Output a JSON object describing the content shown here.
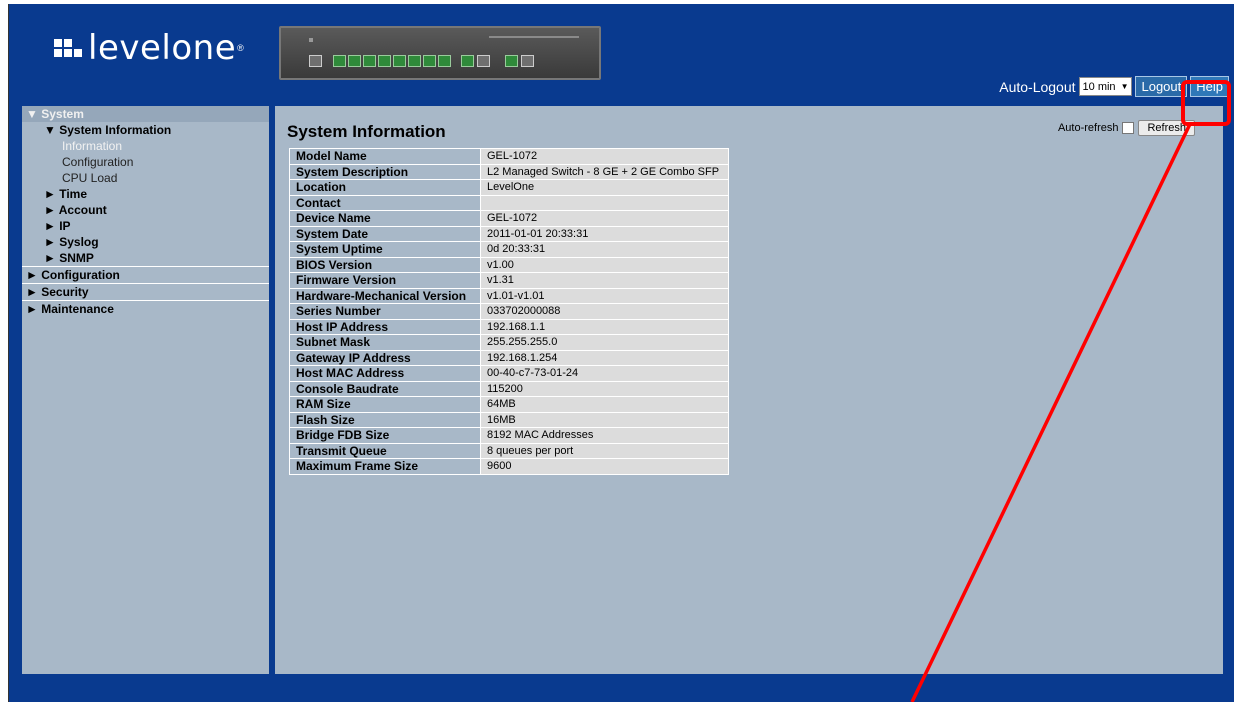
{
  "brand": {
    "name": "levelone",
    "reg": "®"
  },
  "header": {
    "auto_logout_label": "Auto-Logout",
    "auto_logout_value": "10 min",
    "logout_label": "Logout",
    "help_label": "Help"
  },
  "sidebar": {
    "system": "▼ System",
    "system_information": "▼ System Information",
    "information": "Information",
    "configuration_leaf": "Configuration",
    "cpu_load": "CPU Load",
    "time": "► Time",
    "account": "► Account",
    "ip": "► IP",
    "syslog": "► Syslog",
    "snmp": "► SNMP",
    "configuration": "► Configuration",
    "security": "► Security",
    "maintenance": "► Maintenance"
  },
  "main": {
    "title": "System Information",
    "auto_refresh_label": "Auto-refresh",
    "refresh_label": "Refresh"
  },
  "table": {
    "rows": [
      {
        "key": "Model Name",
        "value": "GEL-1072"
      },
      {
        "key": "System Description",
        "value": "L2 Managed Switch - 8 GE + 2 GE Combo SFP"
      },
      {
        "key": "Location",
        "value": "LevelOne"
      },
      {
        "key": "Contact",
        "value": ""
      },
      {
        "key": "Device Name",
        "value": "GEL-1072"
      },
      {
        "key": "System Date",
        "value": "2011-01-01 20:33:31"
      },
      {
        "key": "System Uptime",
        "value": "0d 20:33:31"
      },
      {
        "key": "BIOS Version",
        "value": "v1.00"
      },
      {
        "key": "Firmware Version",
        "value": "v1.31"
      },
      {
        "key": "Hardware-Mechanical Version",
        "value": "v1.01-v1.01"
      },
      {
        "key": "Series Number",
        "value": "033702000088"
      },
      {
        "key": "Host IP Address",
        "value": "192.168.1.1"
      },
      {
        "key": "Subnet Mask",
        "value": "255.255.255.0"
      },
      {
        "key": "Gateway IP Address",
        "value": "192.168.1.254"
      },
      {
        "key": "Host MAC Address",
        "value": "00-40-c7-73-01-24"
      },
      {
        "key": "Console Baudrate",
        "value": "115200"
      },
      {
        "key": "RAM Size",
        "value": "64MB"
      },
      {
        "key": "Flash Size",
        "value": "16MB"
      },
      {
        "key": "Bridge FDB Size",
        "value": "8192 MAC Addresses"
      },
      {
        "key": "Transmit Queue",
        "value": "8 queues per port"
      },
      {
        "key": "Maximum Frame Size",
        "value": "9600"
      }
    ]
  },
  "colors": {
    "header_bg": "#093a8f",
    "panel_bg": "#a8b8c8",
    "annotation": "#ff0000"
  },
  "icons": {
    "logo_mark": "levelone-logo-icon",
    "dropdown": "chevron-down-icon",
    "checkbox": "checkbox-icon"
  }
}
